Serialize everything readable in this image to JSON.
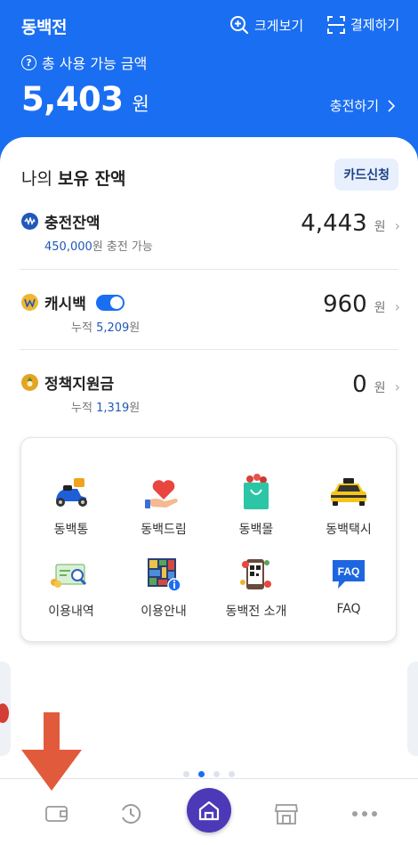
{
  "header": {
    "app_title": "동백전",
    "zoom_label": "크게보기",
    "pay_label": "결제하기",
    "available_label": "총 사용 가능 금액",
    "help_mark": "?",
    "balance_value": "5,403",
    "balance_unit": "원",
    "charge_label": "충전하기"
  },
  "holdings": {
    "title_prefix": "나의 ",
    "title_bold": "보유 잔액",
    "card_apply_label": "카드신청",
    "rows": [
      {
        "title": "충전잔액",
        "sub_value": "450,000",
        "sub_text": "원 충전 가능",
        "amount": "4,443",
        "unit": "원"
      },
      {
        "title": "캐시백",
        "sub_prefix": "누적 ",
        "sub_value": "5,209",
        "sub_text": "원",
        "amount": "960",
        "unit": "원",
        "toggle_on": true
      },
      {
        "title": "정책지원금",
        "sub_prefix": "누적 ",
        "sub_value": "1,319",
        "sub_text": "원",
        "amount": "0",
        "unit": "원"
      }
    ]
  },
  "menu": {
    "items": [
      {
        "label": "동백통",
        "icon": "scooter-icon"
      },
      {
        "label": "동백드림",
        "icon": "heart-hand-icon"
      },
      {
        "label": "동백몰",
        "icon": "shopping-bag-icon"
      },
      {
        "label": "동백택시",
        "icon": "taxi-icon"
      },
      {
        "label": "이용내역",
        "icon": "receipt-search-icon"
      },
      {
        "label": "이용안내",
        "icon": "guide-map-icon"
      },
      {
        "label": "동백전 소개",
        "icon": "phone-qr-icon"
      },
      {
        "label": "FAQ",
        "icon": "faq-bubble-icon",
        "icon_text": "FAQ"
      }
    ]
  },
  "pager": {
    "count": 4,
    "active": 1
  },
  "bottom_nav": {
    "items": [
      "wallet-icon",
      "history-icon",
      "home-icon",
      "store-icon",
      "more-icon"
    ],
    "active": "home-icon"
  },
  "colors": {
    "brand_blue": "#1a6ef2",
    "home_purple": "#4c39b8",
    "annotation_red": "#e25a3c",
    "link_blue": "#1f58b8"
  }
}
